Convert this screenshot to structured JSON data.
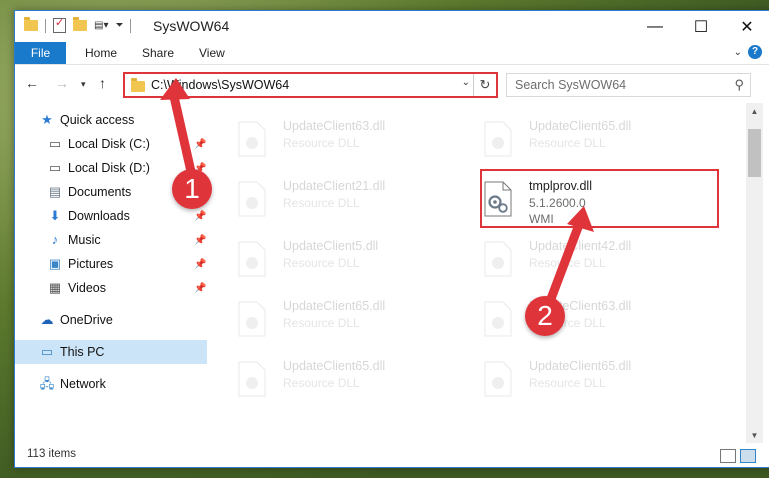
{
  "window": {
    "title": "SysWOW64",
    "minimize_icon": "minimize-icon",
    "maximize_icon": "maximize-icon",
    "close_icon": "close-icon"
  },
  "ribbon": {
    "tabs": [
      "File",
      "Home",
      "Share",
      "View"
    ]
  },
  "nav": {
    "address": "C:\\Windows\\SysWOW64",
    "search_placeholder": "Search SysWOW64"
  },
  "sidebar": {
    "items": [
      {
        "label": "Quick access",
        "icon": "star-icon",
        "pinned": false
      },
      {
        "label": "Local Disk (C:)",
        "icon": "drive-icon",
        "pinned": true
      },
      {
        "label": "Local Disk (D:)",
        "icon": "drive-icon",
        "pinned": true
      },
      {
        "label": "Documents",
        "icon": "documents-icon",
        "pinned": true
      },
      {
        "label": "Downloads",
        "icon": "download-icon",
        "pinned": true
      },
      {
        "label": "Music",
        "icon": "music-icon",
        "pinned": true
      },
      {
        "label": "Pictures",
        "icon": "pictures-icon",
        "pinned": true
      },
      {
        "label": "Videos",
        "icon": "videos-icon",
        "pinned": true
      },
      {
        "label": "OneDrive",
        "icon": "cloud-icon",
        "pinned": false
      },
      {
        "label": "This PC",
        "icon": "computer-icon",
        "pinned": false,
        "selected": true
      },
      {
        "label": "Network",
        "icon": "network-icon",
        "pinned": false
      }
    ]
  },
  "files": [
    {
      "name": "UpdateClient63.dll",
      "line2": "Resource DLL",
      "faded": true
    },
    {
      "name": "UpdateClient65.dll",
      "line2": "Resource DLL",
      "faded": true
    },
    {
      "name": "UpdateClient21.dll",
      "line2": "Resource DLL",
      "faded": true
    },
    {
      "name": "tmplprov.dll",
      "line2": "5.1.2600.0",
      "line3": "WMI",
      "faded": false
    },
    {
      "name": "UpdateClient5.dll",
      "line2": "Resource DLL",
      "faded": true
    },
    {
      "name": "UpdateClient42.dll",
      "line2": "Resource DLL",
      "faded": true
    },
    {
      "name": "UpdateClient65.dll",
      "line2": "Resource DLL",
      "faded": true
    },
    {
      "name": "UpdateClient63.dll",
      "line2": "Resource DLL",
      "faded": true
    },
    {
      "name": "UpdateClient65.dll",
      "line2": "Resource DLL",
      "faded": true
    },
    {
      "name": "UpdateClient65.dll",
      "line2": "Resource DLL",
      "faded": true
    }
  ],
  "status": {
    "items_count": "113 items"
  },
  "annotations": {
    "step1": "1",
    "step2": "2",
    "color": "#e0343b"
  }
}
